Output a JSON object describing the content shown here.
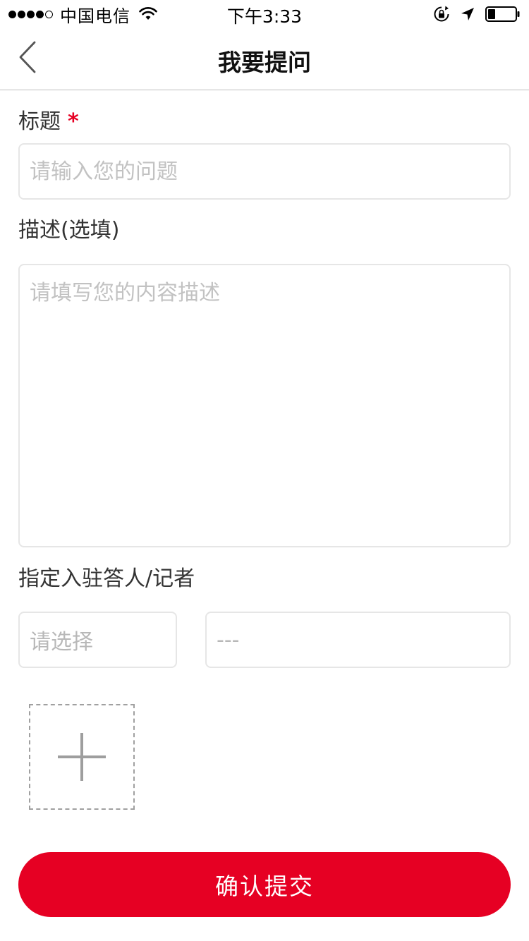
{
  "status_bar": {
    "carrier": "中国电信",
    "time": "下午3:33",
    "signal_bars_filled": 4,
    "signal_bars_total": 5,
    "battery_level": 0.25,
    "icons": [
      "signal-dots-icon",
      "wifi-icon",
      "rotation-lock-icon",
      "location-arrow-icon",
      "battery-icon"
    ]
  },
  "nav": {
    "title": "我要提问",
    "back_icon": "chevron-left-icon"
  },
  "form": {
    "title_label": "标题",
    "required_mark": "*",
    "title_placeholder": "请输入您的问题",
    "title_value": "",
    "description_label": "描述(选填)",
    "description_placeholder": "请填写您的内容描述",
    "description_value": "",
    "assignee_label": "指定入驻答人/记者",
    "assignee_select_value": "请选择",
    "assignee_second_value": "---",
    "upload_icon": "plus-icon"
  },
  "submit": {
    "label": "确认提交"
  },
  "colors": {
    "accent": "#e60023",
    "placeholder": "#c2c2c2",
    "border": "#e6e6e6",
    "divider": "#bdbdbd"
  }
}
